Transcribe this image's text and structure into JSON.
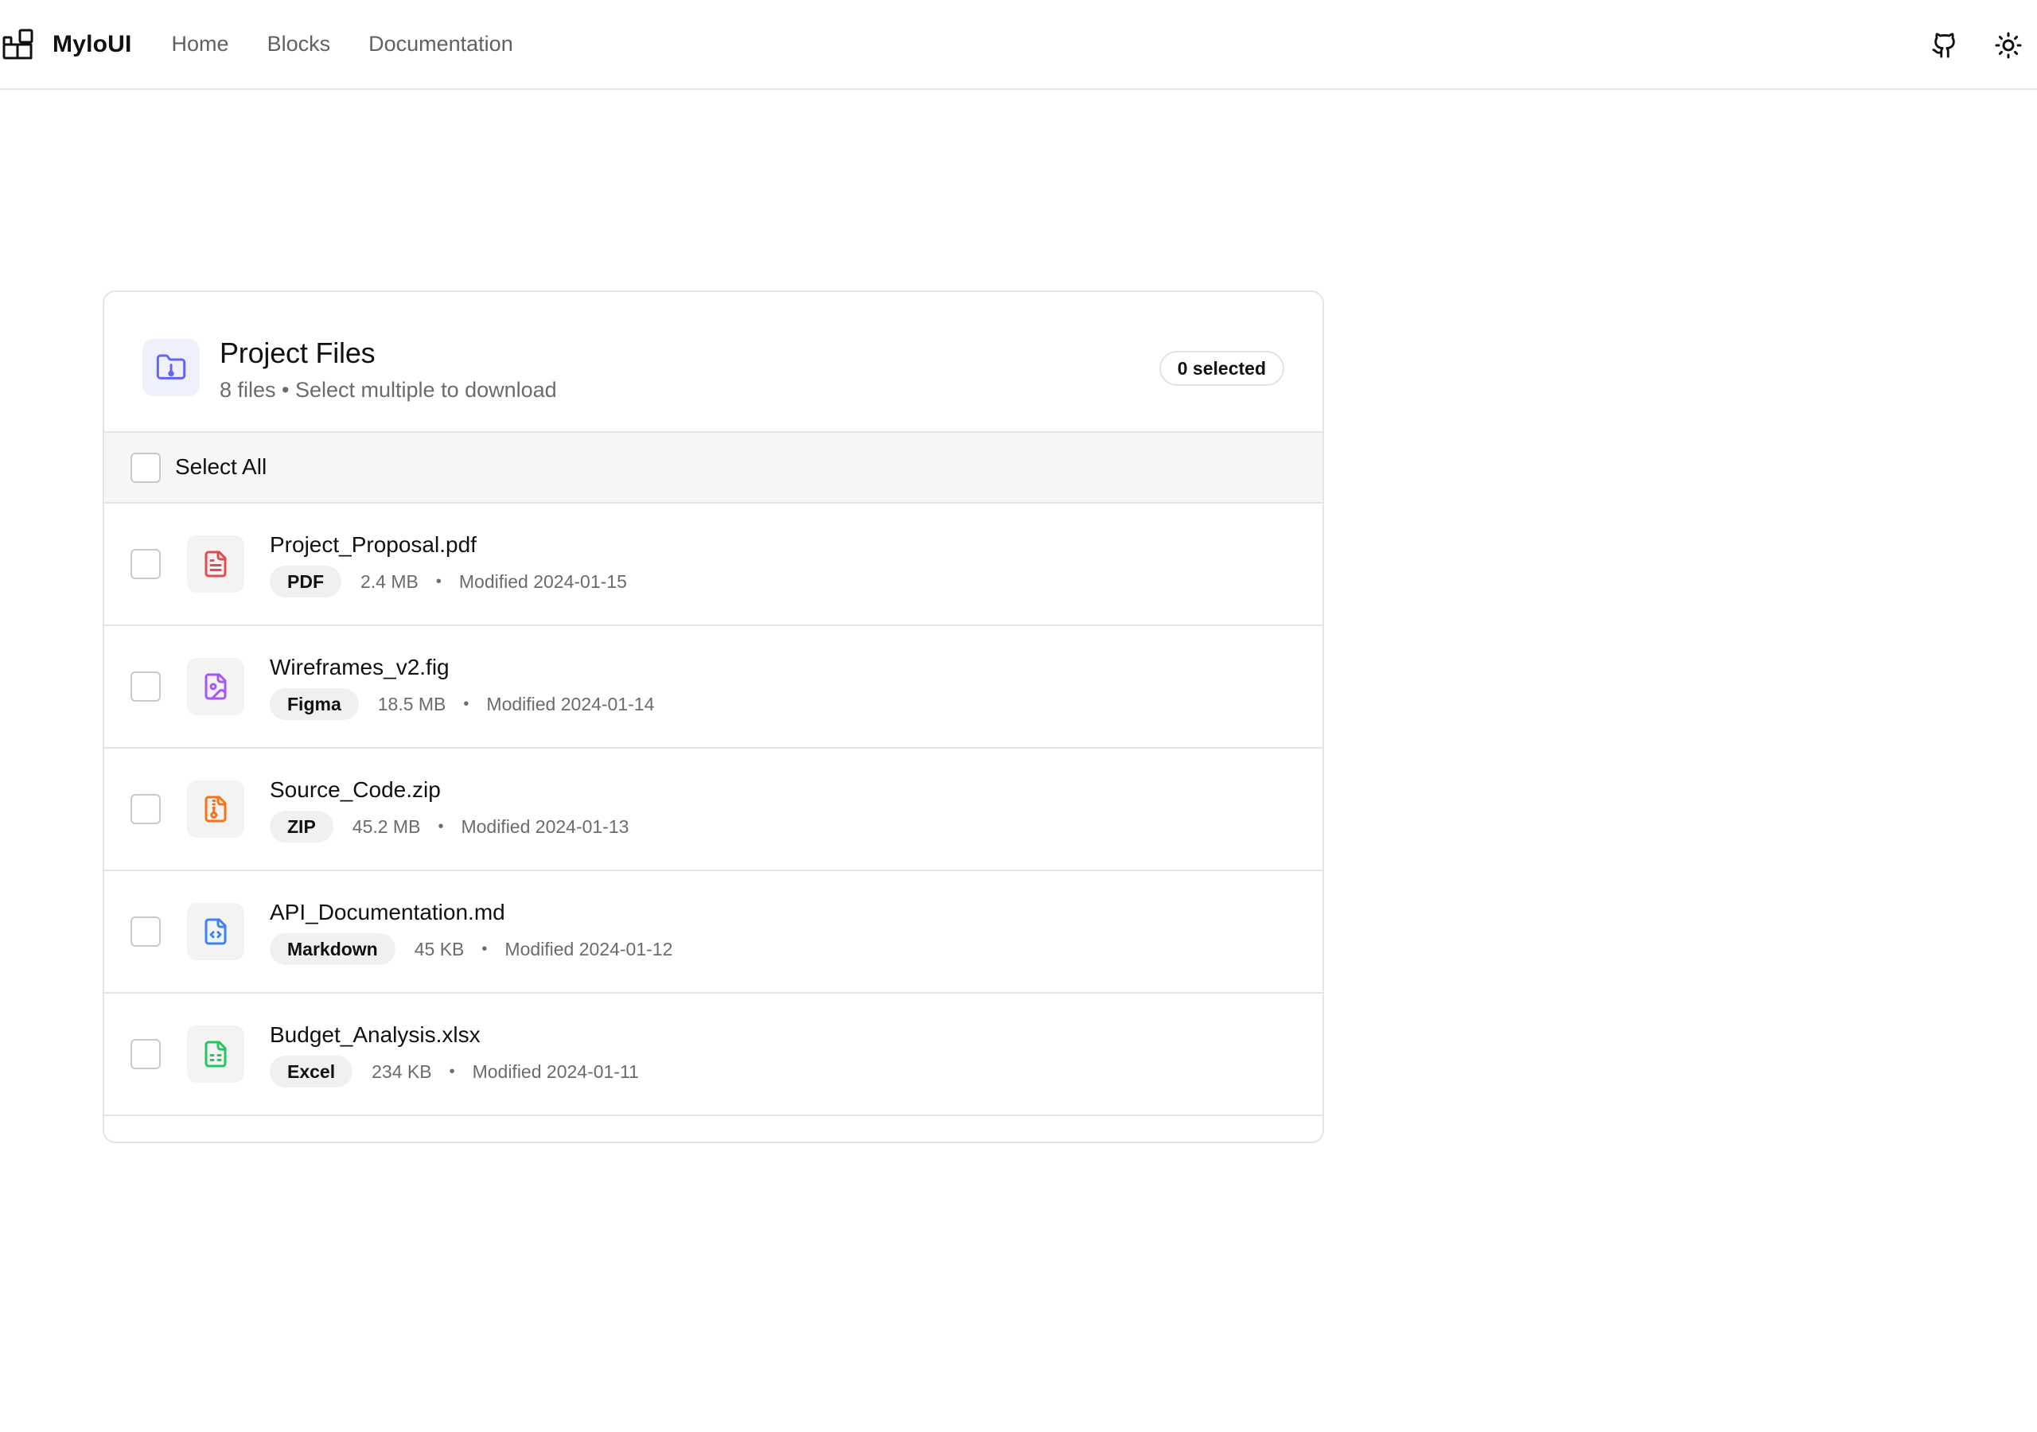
{
  "topbar": {
    "brand_name": "MyloUI",
    "nav": [
      "Home",
      "Blocks",
      "Documentation"
    ],
    "icons": {
      "github": "github-icon",
      "theme": "sun-icon",
      "logo": "blocks-logo-icon"
    }
  },
  "card": {
    "title": "Project Files",
    "subtitle": "8 files • Select multiple to download",
    "selected_badge": "0 selected",
    "select_all_label": "Select All",
    "folder_icon": "folder-icon"
  },
  "files": [
    {
      "name": "Project_Proposal.pdf",
      "type": "PDF",
      "size": "2.4 MB",
      "modified": "Modified 2024-01-15",
      "icon": "file-text-icon",
      "color": "#e5484d"
    },
    {
      "name": "Wireframes_v2.fig",
      "type": "Figma",
      "size": "18.5 MB",
      "modified": "Modified 2024-01-14",
      "icon": "file-image-icon",
      "color": "#a855f7"
    },
    {
      "name": "Source_Code.zip",
      "type": "ZIP",
      "size": "45.2 MB",
      "modified": "Modified 2024-01-13",
      "icon": "file-archive-icon",
      "color": "#f97316"
    },
    {
      "name": "API_Documentation.md",
      "type": "Markdown",
      "size": "45 KB",
      "modified": "Modified 2024-01-12",
      "icon": "file-code-icon",
      "color": "#3b82f6"
    },
    {
      "name": "Budget_Analysis.xlsx",
      "type": "Excel",
      "size": "234 KB",
      "modified": "Modified 2024-01-11",
      "icon": "file-spreadsheet-icon",
      "color": "#22c55e"
    }
  ],
  "meta_separator": "•",
  "colors": {
    "folder_accent": "#6366f1",
    "border": "#e5e5e5"
  }
}
